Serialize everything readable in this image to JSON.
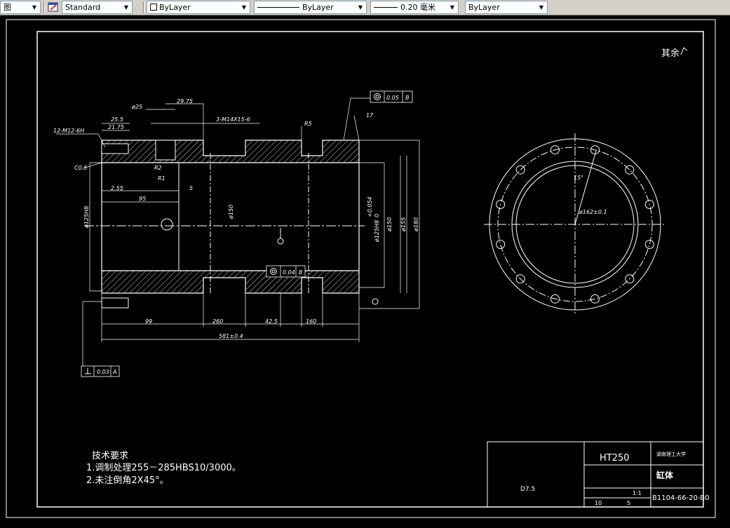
{
  "toolbar": {
    "dd1": "图",
    "textstyle": "Standard",
    "layer_color": "ByLayer",
    "linetype": "ByLayer",
    "lineweight": "0.20 毫米",
    "plotstyle": "ByLayer"
  },
  "drawing": {
    "roughness_note": "其余",
    "dims": {
      "phi25": "ø25",
      "d2975": "29.75",
      "thread": "3-M14X15-6",
      "d255": "25.5",
      "d2175": "21.75",
      "m12": "12-M12-6H",
      "r5": "R5",
      "d17": "17",
      "c05": "C0.5",
      "r2": "R2",
      "r1": "R1",
      "d25": "2.5",
      "d255b": "2.55",
      "d95": "95",
      "d5": "5",
      "phi125h8": "ø125H8",
      "phi150": "ø150",
      "phi125h8b": "ø125H8",
      "tol": "+0.054",
      "tol0": "0",
      "phi150b": "ø150",
      "phi155": "ø155",
      "phi180": "ø180",
      "d99": "99",
      "d260": "260",
      "d425": "42.5",
      "d160": "160",
      "d581": "581±0.4",
      "pcd": "ø162±0.1",
      "ang": "15°"
    },
    "fcf_top": [
      "0.05",
      "B"
    ],
    "fcf_mid": [
      "0.04",
      "B"
    ],
    "fcf_bottom": [
      "0.03",
      "A"
    ],
    "tech_title": "技术要求",
    "tech_1": "1.调制处理255－285HBS10/3000。",
    "tech_2": "2.未注倒角2X45°。"
  },
  "title_block": {
    "material": "HT250",
    "company": "湖南理工大学",
    "part_name": "缸体",
    "drawing_no": "B1104-66-20-B0",
    "scale": "1:1",
    "sheets_total": "10",
    "sheet_no": "5",
    "designer": "D7.5"
  }
}
